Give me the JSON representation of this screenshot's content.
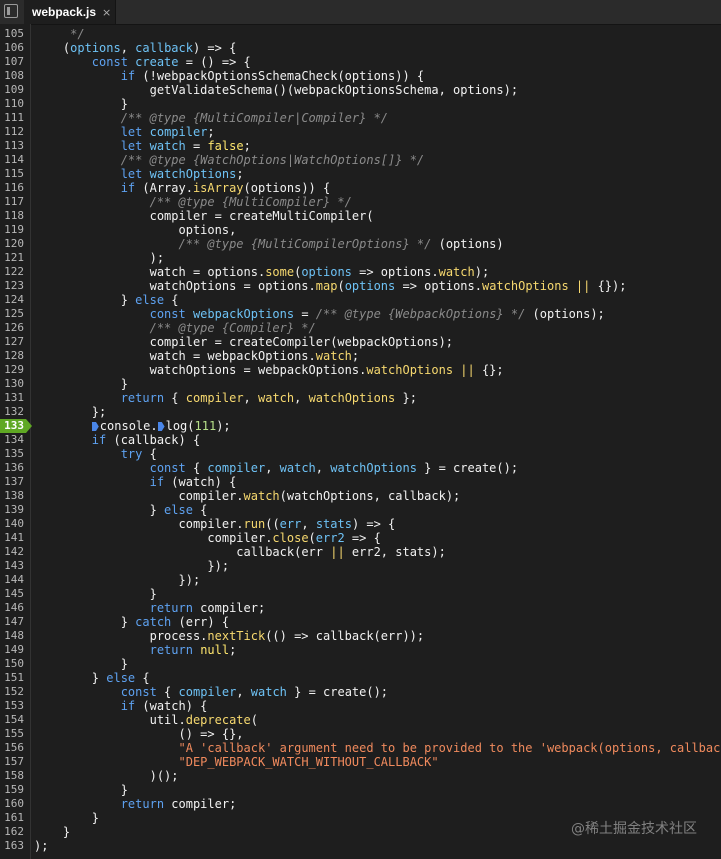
{
  "tab": {
    "title": "webpack.js",
    "close_glyph": "×"
  },
  "watermark": "@稀土掘金技术社区",
  "breakpoint_line": 133,
  "colors": {
    "background": "#1e1e1e",
    "keyword": "#5ea2f1",
    "variable": "#6ec2f5",
    "function": "#f7d96f",
    "comment": "#8a8a8a",
    "string": "#f08a5d",
    "number": "#b7e08a",
    "breakpoint": "#5fa823"
  },
  "lines": [
    {
      "n": 105,
      "t": [
        [
          "cmt",
          "\t */"
        ]
      ]
    },
    {
      "n": 106,
      "t": [
        [
          "plain",
          "\t("
        ],
        [
          "var",
          "options"
        ],
        [
          "plain",
          ", "
        ],
        [
          "var",
          "callback"
        ],
        [
          "plain",
          ") => {"
        ]
      ]
    },
    {
      "n": 107,
      "t": [
        [
          "plain",
          "\t\t"
        ],
        [
          "kw",
          "const"
        ],
        [
          "plain",
          " "
        ],
        [
          "var",
          "create"
        ],
        [
          "plain",
          " = () => {"
        ]
      ]
    },
    {
      "n": 108,
      "t": [
        [
          "plain",
          "\t\t\t"
        ],
        [
          "kw",
          "if"
        ],
        [
          "plain",
          " (!webpackOptionsSchemaCheck(options)) {"
        ]
      ]
    },
    {
      "n": 109,
      "t": [
        [
          "plain",
          "\t\t\t\tgetValidateSchema()(webpackOptionsSchema, options);"
        ]
      ]
    },
    {
      "n": 110,
      "t": [
        [
          "plain",
          "\t\t\t}"
        ]
      ]
    },
    {
      "n": 111,
      "t": [
        [
          "plain",
          "\t\t\t"
        ],
        [
          "cmt",
          "/** @type {MultiCompiler|Compiler} */"
        ]
      ]
    },
    {
      "n": 112,
      "t": [
        [
          "plain",
          "\t\t\t"
        ],
        [
          "kw",
          "let"
        ],
        [
          "plain",
          " "
        ],
        [
          "var",
          "compiler"
        ],
        [
          "plain",
          ";"
        ]
      ]
    },
    {
      "n": 113,
      "t": [
        [
          "plain",
          "\t\t\t"
        ],
        [
          "kw",
          "let"
        ],
        [
          "plain",
          " "
        ],
        [
          "var",
          "watch"
        ],
        [
          "plain",
          " = "
        ],
        [
          "bool",
          "false"
        ],
        [
          "plain",
          ";"
        ]
      ]
    },
    {
      "n": 114,
      "t": [
        [
          "plain",
          "\t\t\t"
        ],
        [
          "cmt",
          "/** @type {WatchOptions|WatchOptions[]} */"
        ]
      ]
    },
    {
      "n": 115,
      "t": [
        [
          "plain",
          "\t\t\t"
        ],
        [
          "kw",
          "let"
        ],
        [
          "plain",
          " "
        ],
        [
          "var",
          "watchOptions"
        ],
        [
          "plain",
          ";"
        ]
      ]
    },
    {
      "n": 116,
      "t": [
        [
          "plain",
          "\t\t\t"
        ],
        [
          "kw",
          "if"
        ],
        [
          "plain",
          " (Array."
        ],
        [
          "fn",
          "isArray"
        ],
        [
          "plain",
          "(options)) {"
        ]
      ]
    },
    {
      "n": 117,
      "t": [
        [
          "plain",
          "\t\t\t\t"
        ],
        [
          "cmt",
          "/** @type {MultiCompiler} */"
        ]
      ]
    },
    {
      "n": 118,
      "t": [
        [
          "plain",
          "\t\t\t\tcompiler = createMultiCompiler("
        ]
      ]
    },
    {
      "n": 119,
      "t": [
        [
          "plain",
          "\t\t\t\t\toptions,"
        ]
      ]
    },
    {
      "n": 120,
      "t": [
        [
          "plain",
          "\t\t\t\t\t"
        ],
        [
          "cmt",
          "/** @type {MultiCompilerOptions} */"
        ],
        [
          "plain",
          " (options)"
        ]
      ]
    },
    {
      "n": 121,
      "t": [
        [
          "plain",
          "\t\t\t\t);"
        ]
      ]
    },
    {
      "n": 122,
      "t": [
        [
          "plain",
          "\t\t\t\twatch = options."
        ],
        [
          "fn",
          "some"
        ],
        [
          "plain",
          "("
        ],
        [
          "var",
          "options"
        ],
        [
          "plain",
          " => options."
        ],
        [
          "fn",
          "watch"
        ],
        [
          "plain",
          ");"
        ]
      ]
    },
    {
      "n": 123,
      "t": [
        [
          "plain",
          "\t\t\t\twatchOptions = options."
        ],
        [
          "fn",
          "map"
        ],
        [
          "plain",
          "("
        ],
        [
          "var",
          "options"
        ],
        [
          "plain",
          " => options."
        ],
        [
          "fn",
          "watchOptions"
        ],
        [
          "plain",
          " "
        ],
        [
          "fn",
          "||"
        ],
        [
          "plain",
          " {});"
        ]
      ]
    },
    {
      "n": 124,
      "t": [
        [
          "plain",
          "\t\t\t} "
        ],
        [
          "kw",
          "else"
        ],
        [
          "plain",
          " {"
        ]
      ]
    },
    {
      "n": 125,
      "t": [
        [
          "plain",
          "\t\t\t\t"
        ],
        [
          "kw",
          "const"
        ],
        [
          "plain",
          " "
        ],
        [
          "var",
          "webpackOptions"
        ],
        [
          "plain",
          " = "
        ],
        [
          "cmt",
          "/** @type {WebpackOptions} */"
        ],
        [
          "plain",
          " (options);"
        ]
      ]
    },
    {
      "n": 126,
      "t": [
        [
          "plain",
          "\t\t\t\t"
        ],
        [
          "cmt",
          "/** @type {Compiler} */"
        ]
      ]
    },
    {
      "n": 127,
      "t": [
        [
          "plain",
          "\t\t\t\tcompiler = createCompiler(webpackOptions);"
        ]
      ]
    },
    {
      "n": 128,
      "t": [
        [
          "plain",
          "\t\t\t\twatch = webpackOptions."
        ],
        [
          "fn",
          "watch"
        ],
        [
          "plain",
          ";"
        ]
      ]
    },
    {
      "n": 129,
      "t": [
        [
          "plain",
          "\t\t\t\twatchOptions = webpackOptions."
        ],
        [
          "fn",
          "watchOptions"
        ],
        [
          "plain",
          " "
        ],
        [
          "fn",
          "||"
        ],
        [
          "plain",
          " {};"
        ]
      ]
    },
    {
      "n": 130,
      "t": [
        [
          "plain",
          "\t\t\t}"
        ]
      ]
    },
    {
      "n": 131,
      "t": [
        [
          "plain",
          "\t\t\t"
        ],
        [
          "kw",
          "return"
        ],
        [
          "plain",
          " { "
        ],
        [
          "fn",
          "compiler"
        ],
        [
          "plain",
          ", "
        ],
        [
          "fn",
          "watch"
        ],
        [
          "plain",
          ", "
        ],
        [
          "fn",
          "watchOptions"
        ],
        [
          "plain",
          " };"
        ]
      ]
    },
    {
      "n": 132,
      "t": [
        [
          "plain",
          "\t\t};"
        ]
      ]
    },
    {
      "n": 133,
      "t": [
        [
          "plain",
          "\t\t"
        ],
        [
          "mark",
          ""
        ],
        [
          "plain",
          "console."
        ],
        [
          "mark",
          ""
        ],
        [
          "plain",
          "log("
        ],
        [
          "num",
          "111"
        ],
        [
          "plain",
          ");"
        ]
      ]
    },
    {
      "n": 134,
      "t": [
        [
          "plain",
          "\t\t"
        ],
        [
          "kw",
          "if"
        ],
        [
          "plain",
          " (callback) {"
        ]
      ]
    },
    {
      "n": 135,
      "t": [
        [
          "plain",
          "\t\t\t"
        ],
        [
          "kw",
          "try"
        ],
        [
          "plain",
          " {"
        ]
      ]
    },
    {
      "n": 136,
      "t": [
        [
          "plain",
          "\t\t\t\t"
        ],
        [
          "kw",
          "const"
        ],
        [
          "plain",
          " { "
        ],
        [
          "var",
          "compiler"
        ],
        [
          "plain",
          ", "
        ],
        [
          "var",
          "watch"
        ],
        [
          "plain",
          ", "
        ],
        [
          "var",
          "watchOptions"
        ],
        [
          "plain",
          " } = create();"
        ]
      ]
    },
    {
      "n": 137,
      "t": [
        [
          "plain",
          "\t\t\t\t"
        ],
        [
          "kw",
          "if"
        ],
        [
          "plain",
          " (watch) {"
        ]
      ]
    },
    {
      "n": 138,
      "t": [
        [
          "plain",
          "\t\t\t\t\tcompiler."
        ],
        [
          "fn",
          "watch"
        ],
        [
          "plain",
          "(watchOptions, callback);"
        ]
      ]
    },
    {
      "n": 139,
      "t": [
        [
          "plain",
          "\t\t\t\t} "
        ],
        [
          "kw",
          "else"
        ],
        [
          "plain",
          " {"
        ]
      ]
    },
    {
      "n": 140,
      "t": [
        [
          "plain",
          "\t\t\t\t\tcompiler."
        ],
        [
          "fn",
          "run"
        ],
        [
          "plain",
          "(("
        ],
        [
          "var",
          "err"
        ],
        [
          "plain",
          ", "
        ],
        [
          "var",
          "stats"
        ],
        [
          "plain",
          ") => {"
        ]
      ]
    },
    {
      "n": 141,
      "t": [
        [
          "plain",
          "\t\t\t\t\t\tcompiler."
        ],
        [
          "fn",
          "close"
        ],
        [
          "plain",
          "("
        ],
        [
          "var",
          "err2"
        ],
        [
          "plain",
          " => {"
        ]
      ]
    },
    {
      "n": 142,
      "t": [
        [
          "plain",
          "\t\t\t\t\t\t\tcallback(err "
        ],
        [
          "fn",
          "||"
        ],
        [
          "plain",
          " err2, stats);"
        ]
      ]
    },
    {
      "n": 143,
      "t": [
        [
          "plain",
          "\t\t\t\t\t\t});"
        ]
      ]
    },
    {
      "n": 144,
      "t": [
        [
          "plain",
          "\t\t\t\t\t});"
        ]
      ]
    },
    {
      "n": 145,
      "t": [
        [
          "plain",
          "\t\t\t\t}"
        ]
      ]
    },
    {
      "n": 146,
      "t": [
        [
          "plain",
          "\t\t\t\t"
        ],
        [
          "kw",
          "return"
        ],
        [
          "plain",
          " compiler;"
        ]
      ]
    },
    {
      "n": 147,
      "t": [
        [
          "plain",
          "\t\t\t} "
        ],
        [
          "kw",
          "catch"
        ],
        [
          "plain",
          " (err) {"
        ]
      ]
    },
    {
      "n": 148,
      "t": [
        [
          "plain",
          "\t\t\t\tprocess."
        ],
        [
          "fn",
          "nextTick"
        ],
        [
          "plain",
          "(() => callback(err));"
        ]
      ]
    },
    {
      "n": 149,
      "t": [
        [
          "plain",
          "\t\t\t\t"
        ],
        [
          "kw",
          "return"
        ],
        [
          "plain",
          " "
        ],
        [
          "bool",
          "null"
        ],
        [
          "plain",
          ";"
        ]
      ]
    },
    {
      "n": 150,
      "t": [
        [
          "plain",
          "\t\t\t}"
        ]
      ]
    },
    {
      "n": 151,
      "t": [
        [
          "plain",
          "\t\t} "
        ],
        [
          "kw",
          "else"
        ],
        [
          "plain",
          " {"
        ]
      ]
    },
    {
      "n": 152,
      "t": [
        [
          "plain",
          "\t\t\t"
        ],
        [
          "kw",
          "const"
        ],
        [
          "plain",
          " { "
        ],
        [
          "var",
          "compiler"
        ],
        [
          "plain",
          ", "
        ],
        [
          "var",
          "watch"
        ],
        [
          "plain",
          " } = create();"
        ]
      ]
    },
    {
      "n": 153,
      "t": [
        [
          "plain",
          "\t\t\t"
        ],
        [
          "kw",
          "if"
        ],
        [
          "plain",
          " (watch) {"
        ]
      ]
    },
    {
      "n": 154,
      "t": [
        [
          "plain",
          "\t\t\t\tutil."
        ],
        [
          "fn",
          "deprecate"
        ],
        [
          "plain",
          "("
        ]
      ]
    },
    {
      "n": 155,
      "t": [
        [
          "plain",
          "\t\t\t\t\t() => {},"
        ]
      ]
    },
    {
      "n": 156,
      "t": [
        [
          "plain",
          "\t\t\t\t\t"
        ],
        [
          "str",
          "\"A 'callback' argument need to be provided to the 'webpack(options, callback)'"
        ]
      ]
    },
    {
      "n": 157,
      "t": [
        [
          "plain",
          "\t\t\t\t\t"
        ],
        [
          "str",
          "\"DEP_WEBPACK_WATCH_WITHOUT_CALLBACK\""
        ]
      ]
    },
    {
      "n": 158,
      "t": [
        [
          "plain",
          "\t\t\t\t)();"
        ]
      ]
    },
    {
      "n": 159,
      "t": [
        [
          "plain",
          "\t\t\t}"
        ]
      ]
    },
    {
      "n": 160,
      "t": [
        [
          "plain",
          "\t\t\t"
        ],
        [
          "kw",
          "return"
        ],
        [
          "plain",
          " compiler;"
        ]
      ]
    },
    {
      "n": 161,
      "t": [
        [
          "plain",
          "\t\t}"
        ]
      ]
    },
    {
      "n": 162,
      "t": [
        [
          "plain",
          "\t}"
        ]
      ]
    },
    {
      "n": 163,
      "t": [
        [
          "plain",
          ");"
        ]
      ]
    }
  ]
}
